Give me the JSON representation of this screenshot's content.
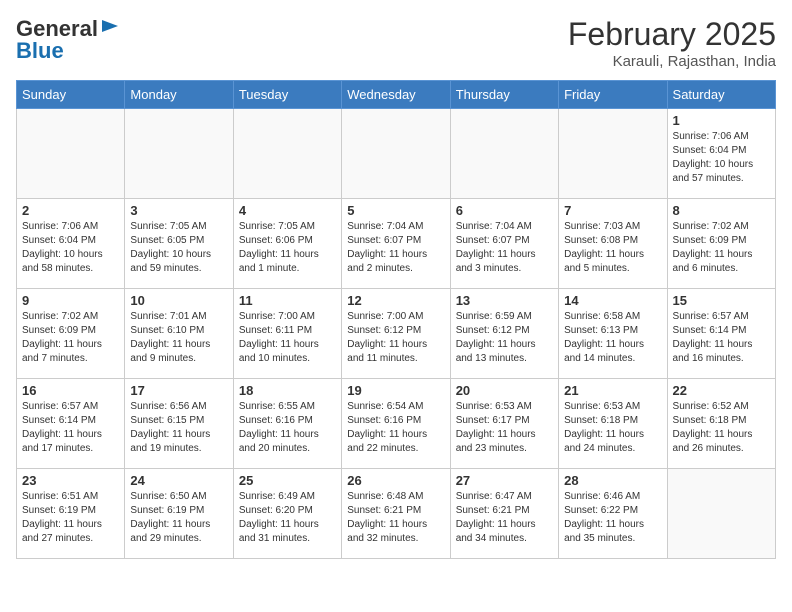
{
  "header": {
    "logo_general": "General",
    "logo_blue": "Blue",
    "month_title": "February 2025",
    "location": "Karauli, Rajasthan, India"
  },
  "weekdays": [
    "Sunday",
    "Monday",
    "Tuesday",
    "Wednesday",
    "Thursday",
    "Friday",
    "Saturday"
  ],
  "weeks": [
    [
      {
        "day": "",
        "info": ""
      },
      {
        "day": "",
        "info": ""
      },
      {
        "day": "",
        "info": ""
      },
      {
        "day": "",
        "info": ""
      },
      {
        "day": "",
        "info": ""
      },
      {
        "day": "",
        "info": ""
      },
      {
        "day": "1",
        "info": "Sunrise: 7:06 AM\nSunset: 6:04 PM\nDaylight: 10 hours\nand 57 minutes."
      }
    ],
    [
      {
        "day": "2",
        "info": "Sunrise: 7:06 AM\nSunset: 6:04 PM\nDaylight: 10 hours\nand 58 minutes."
      },
      {
        "day": "3",
        "info": "Sunrise: 7:05 AM\nSunset: 6:05 PM\nDaylight: 10 hours\nand 59 minutes."
      },
      {
        "day": "4",
        "info": "Sunrise: 7:05 AM\nSunset: 6:06 PM\nDaylight: 11 hours\nand 1 minute."
      },
      {
        "day": "5",
        "info": "Sunrise: 7:04 AM\nSunset: 6:07 PM\nDaylight: 11 hours\nand 2 minutes."
      },
      {
        "day": "6",
        "info": "Sunrise: 7:04 AM\nSunset: 6:07 PM\nDaylight: 11 hours\nand 3 minutes."
      },
      {
        "day": "7",
        "info": "Sunrise: 7:03 AM\nSunset: 6:08 PM\nDaylight: 11 hours\nand 5 minutes."
      },
      {
        "day": "8",
        "info": "Sunrise: 7:02 AM\nSunset: 6:09 PM\nDaylight: 11 hours\nand 6 minutes."
      }
    ],
    [
      {
        "day": "9",
        "info": "Sunrise: 7:02 AM\nSunset: 6:09 PM\nDaylight: 11 hours\nand 7 minutes."
      },
      {
        "day": "10",
        "info": "Sunrise: 7:01 AM\nSunset: 6:10 PM\nDaylight: 11 hours\nand 9 minutes."
      },
      {
        "day": "11",
        "info": "Sunrise: 7:00 AM\nSunset: 6:11 PM\nDaylight: 11 hours\nand 10 minutes."
      },
      {
        "day": "12",
        "info": "Sunrise: 7:00 AM\nSunset: 6:12 PM\nDaylight: 11 hours\nand 11 minutes."
      },
      {
        "day": "13",
        "info": "Sunrise: 6:59 AM\nSunset: 6:12 PM\nDaylight: 11 hours\nand 13 minutes."
      },
      {
        "day": "14",
        "info": "Sunrise: 6:58 AM\nSunset: 6:13 PM\nDaylight: 11 hours\nand 14 minutes."
      },
      {
        "day": "15",
        "info": "Sunrise: 6:57 AM\nSunset: 6:14 PM\nDaylight: 11 hours\nand 16 minutes."
      }
    ],
    [
      {
        "day": "16",
        "info": "Sunrise: 6:57 AM\nSunset: 6:14 PM\nDaylight: 11 hours\nand 17 minutes."
      },
      {
        "day": "17",
        "info": "Sunrise: 6:56 AM\nSunset: 6:15 PM\nDaylight: 11 hours\nand 19 minutes."
      },
      {
        "day": "18",
        "info": "Sunrise: 6:55 AM\nSunset: 6:16 PM\nDaylight: 11 hours\nand 20 minutes."
      },
      {
        "day": "19",
        "info": "Sunrise: 6:54 AM\nSunset: 6:16 PM\nDaylight: 11 hours\nand 22 minutes."
      },
      {
        "day": "20",
        "info": "Sunrise: 6:53 AM\nSunset: 6:17 PM\nDaylight: 11 hours\nand 23 minutes."
      },
      {
        "day": "21",
        "info": "Sunrise: 6:53 AM\nSunset: 6:18 PM\nDaylight: 11 hours\nand 24 minutes."
      },
      {
        "day": "22",
        "info": "Sunrise: 6:52 AM\nSunset: 6:18 PM\nDaylight: 11 hours\nand 26 minutes."
      }
    ],
    [
      {
        "day": "23",
        "info": "Sunrise: 6:51 AM\nSunset: 6:19 PM\nDaylight: 11 hours\nand 27 minutes."
      },
      {
        "day": "24",
        "info": "Sunrise: 6:50 AM\nSunset: 6:19 PM\nDaylight: 11 hours\nand 29 minutes."
      },
      {
        "day": "25",
        "info": "Sunrise: 6:49 AM\nSunset: 6:20 PM\nDaylight: 11 hours\nand 31 minutes."
      },
      {
        "day": "26",
        "info": "Sunrise: 6:48 AM\nSunset: 6:21 PM\nDaylight: 11 hours\nand 32 minutes."
      },
      {
        "day": "27",
        "info": "Sunrise: 6:47 AM\nSunset: 6:21 PM\nDaylight: 11 hours\nand 34 minutes."
      },
      {
        "day": "28",
        "info": "Sunrise: 6:46 AM\nSunset: 6:22 PM\nDaylight: 11 hours\nand 35 minutes."
      },
      {
        "day": "",
        "info": ""
      }
    ]
  ]
}
